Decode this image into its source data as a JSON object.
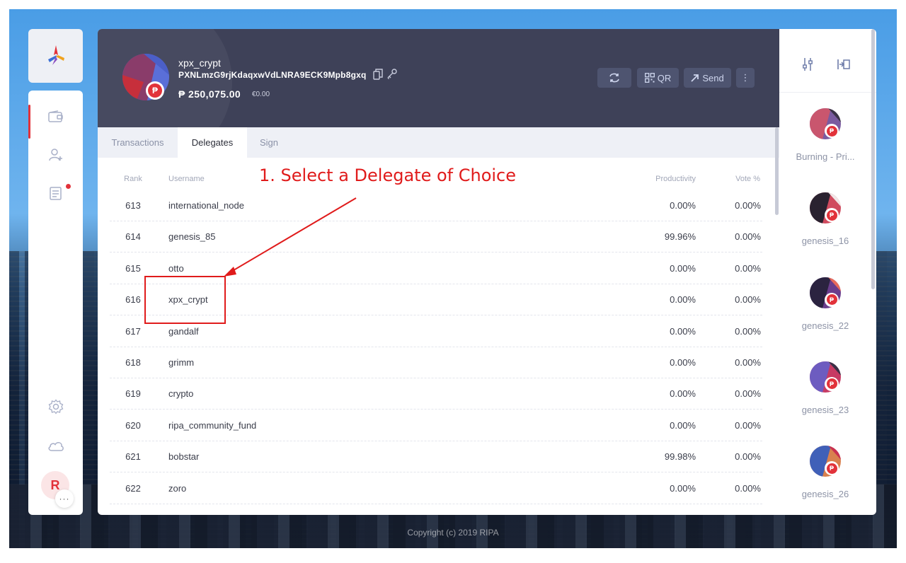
{
  "colors": {
    "accent": "#e2323a",
    "header_bg": "#3e4158",
    "annotation": "#e01b1b"
  },
  "footer": {
    "copyright": "Copyright (c) 2019 RIPA"
  },
  "sidebar": {
    "items": [
      {
        "name": "wallet-icon",
        "active": true
      },
      {
        "name": "add-contact-icon",
        "active": false
      },
      {
        "name": "contacts-icon",
        "active": false,
        "notification": true
      },
      {
        "name": "settings-icon"
      },
      {
        "name": "cloud-icon"
      }
    ],
    "profile_initial": "R",
    "more_label": "···"
  },
  "wallet": {
    "name": "xpx_crypt",
    "address": "PXNLmzG9rjKdaqxwVdLNRA9ECK9Mpb8gxq",
    "balance": "₱ 250,075.00",
    "fiat": "€0.00",
    "currency_symbol": "₱"
  },
  "actions": {
    "refresh_icon": "refresh-icon",
    "qr_label": "QR",
    "send_label": "Send",
    "more_label": "⋮"
  },
  "tabs": [
    {
      "label": "Transactions"
    },
    {
      "label": "Delegates"
    },
    {
      "label": "Sign"
    }
  ],
  "table": {
    "headers": {
      "rank": "Rank",
      "username": "Username",
      "productivity": "Productivity",
      "vote": "Vote %"
    },
    "rows": [
      {
        "rank": "613",
        "username": "international_node",
        "productivity": "0.00%",
        "vote": "0.00%"
      },
      {
        "rank": "614",
        "username": "genesis_85",
        "productivity": "99.96%",
        "vote": "0.00%"
      },
      {
        "rank": "615",
        "username": "otto",
        "productivity": "0.00%",
        "vote": "0.00%"
      },
      {
        "rank": "616",
        "username": "xpx_crypt",
        "productivity": "0.00%",
        "vote": "0.00%"
      },
      {
        "rank": "617",
        "username": "gandalf",
        "productivity": "0.00%",
        "vote": "0.00%"
      },
      {
        "rank": "618",
        "username": "grimm",
        "productivity": "0.00%",
        "vote": "0.00%"
      },
      {
        "rank": "619",
        "username": "crypto",
        "productivity": "0.00%",
        "vote": "0.00%"
      },
      {
        "rank": "620",
        "username": "ripa_community_fund",
        "productivity": "0.00%",
        "vote": "0.00%"
      },
      {
        "rank": "621",
        "username": "bobstar",
        "productivity": "99.98%",
        "vote": "0.00%"
      },
      {
        "rank": "622",
        "username": "zoro",
        "productivity": "0.00%",
        "vote": "0.00%"
      }
    ]
  },
  "annotation": {
    "text": "1. Select a Delegate of Choice"
  },
  "wallets_sidebar": {
    "items": [
      {
        "label": "Burning - Pri...",
        "c1": "#7a5ba0",
        "c2": "#c9566e",
        "c3": "#3a3346"
      },
      {
        "label": "genesis_16",
        "c1": "#d04a5e",
        "c2": "#2a2230",
        "c3": "#f0e6e6"
      },
      {
        "label": "genesis_22",
        "c1": "#6a3d8c",
        "c2": "#2b2340",
        "c3": "#e96a5a"
      },
      {
        "label": "genesis_23",
        "c1": "#c73a63",
        "c2": "#6d5cc0",
        "c3": "#3a3046"
      },
      {
        "label": "genesis_26",
        "c1": "#d9804e",
        "c2": "#4060b8",
        "c3": "#c93050"
      }
    ]
  }
}
